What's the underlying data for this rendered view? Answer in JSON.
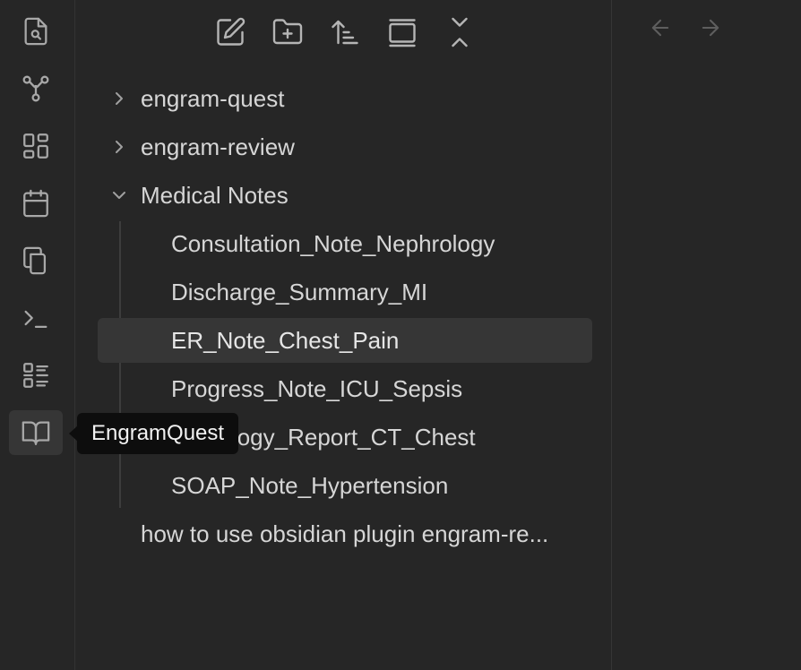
{
  "ribbon": {
    "icons": [
      "search-files-icon",
      "graph-view-icon",
      "canvas-icon",
      "daily-notes-icon",
      "templates-icon",
      "command-palette-icon",
      "slides-icon",
      "engram-quest-icon"
    ]
  },
  "toolbar": {
    "icons": [
      "new-note-icon",
      "new-folder-icon",
      "sort-icon",
      "auto-reveal-icon",
      "collapse-all-icon"
    ]
  },
  "tree": {
    "folders": [
      {
        "label": "engram-quest",
        "expanded": false
      },
      {
        "label": "engram-review",
        "expanded": false
      },
      {
        "label": "Medical Notes",
        "expanded": true
      }
    ],
    "files": [
      "Consultation_Note_Nephrology",
      "Discharge_Summary_MI",
      "ER_Note_Chest_Pain",
      "Progress_Note_ICU_Sepsis",
      "Radiology_Report_CT_Chest",
      "SOAP_Note_Hypertension"
    ],
    "root_file": "how to use obsidian plugin engram-re...",
    "selected": "ER_Note_Chest_Pain"
  },
  "tooltip": {
    "text": "EngramQuest"
  },
  "colors": {
    "background": "#262626",
    "selected": "#363636",
    "tooltip_bg": "#0d0d0d",
    "text": "#d6d6d6",
    "icon": "#a8a8a8"
  }
}
